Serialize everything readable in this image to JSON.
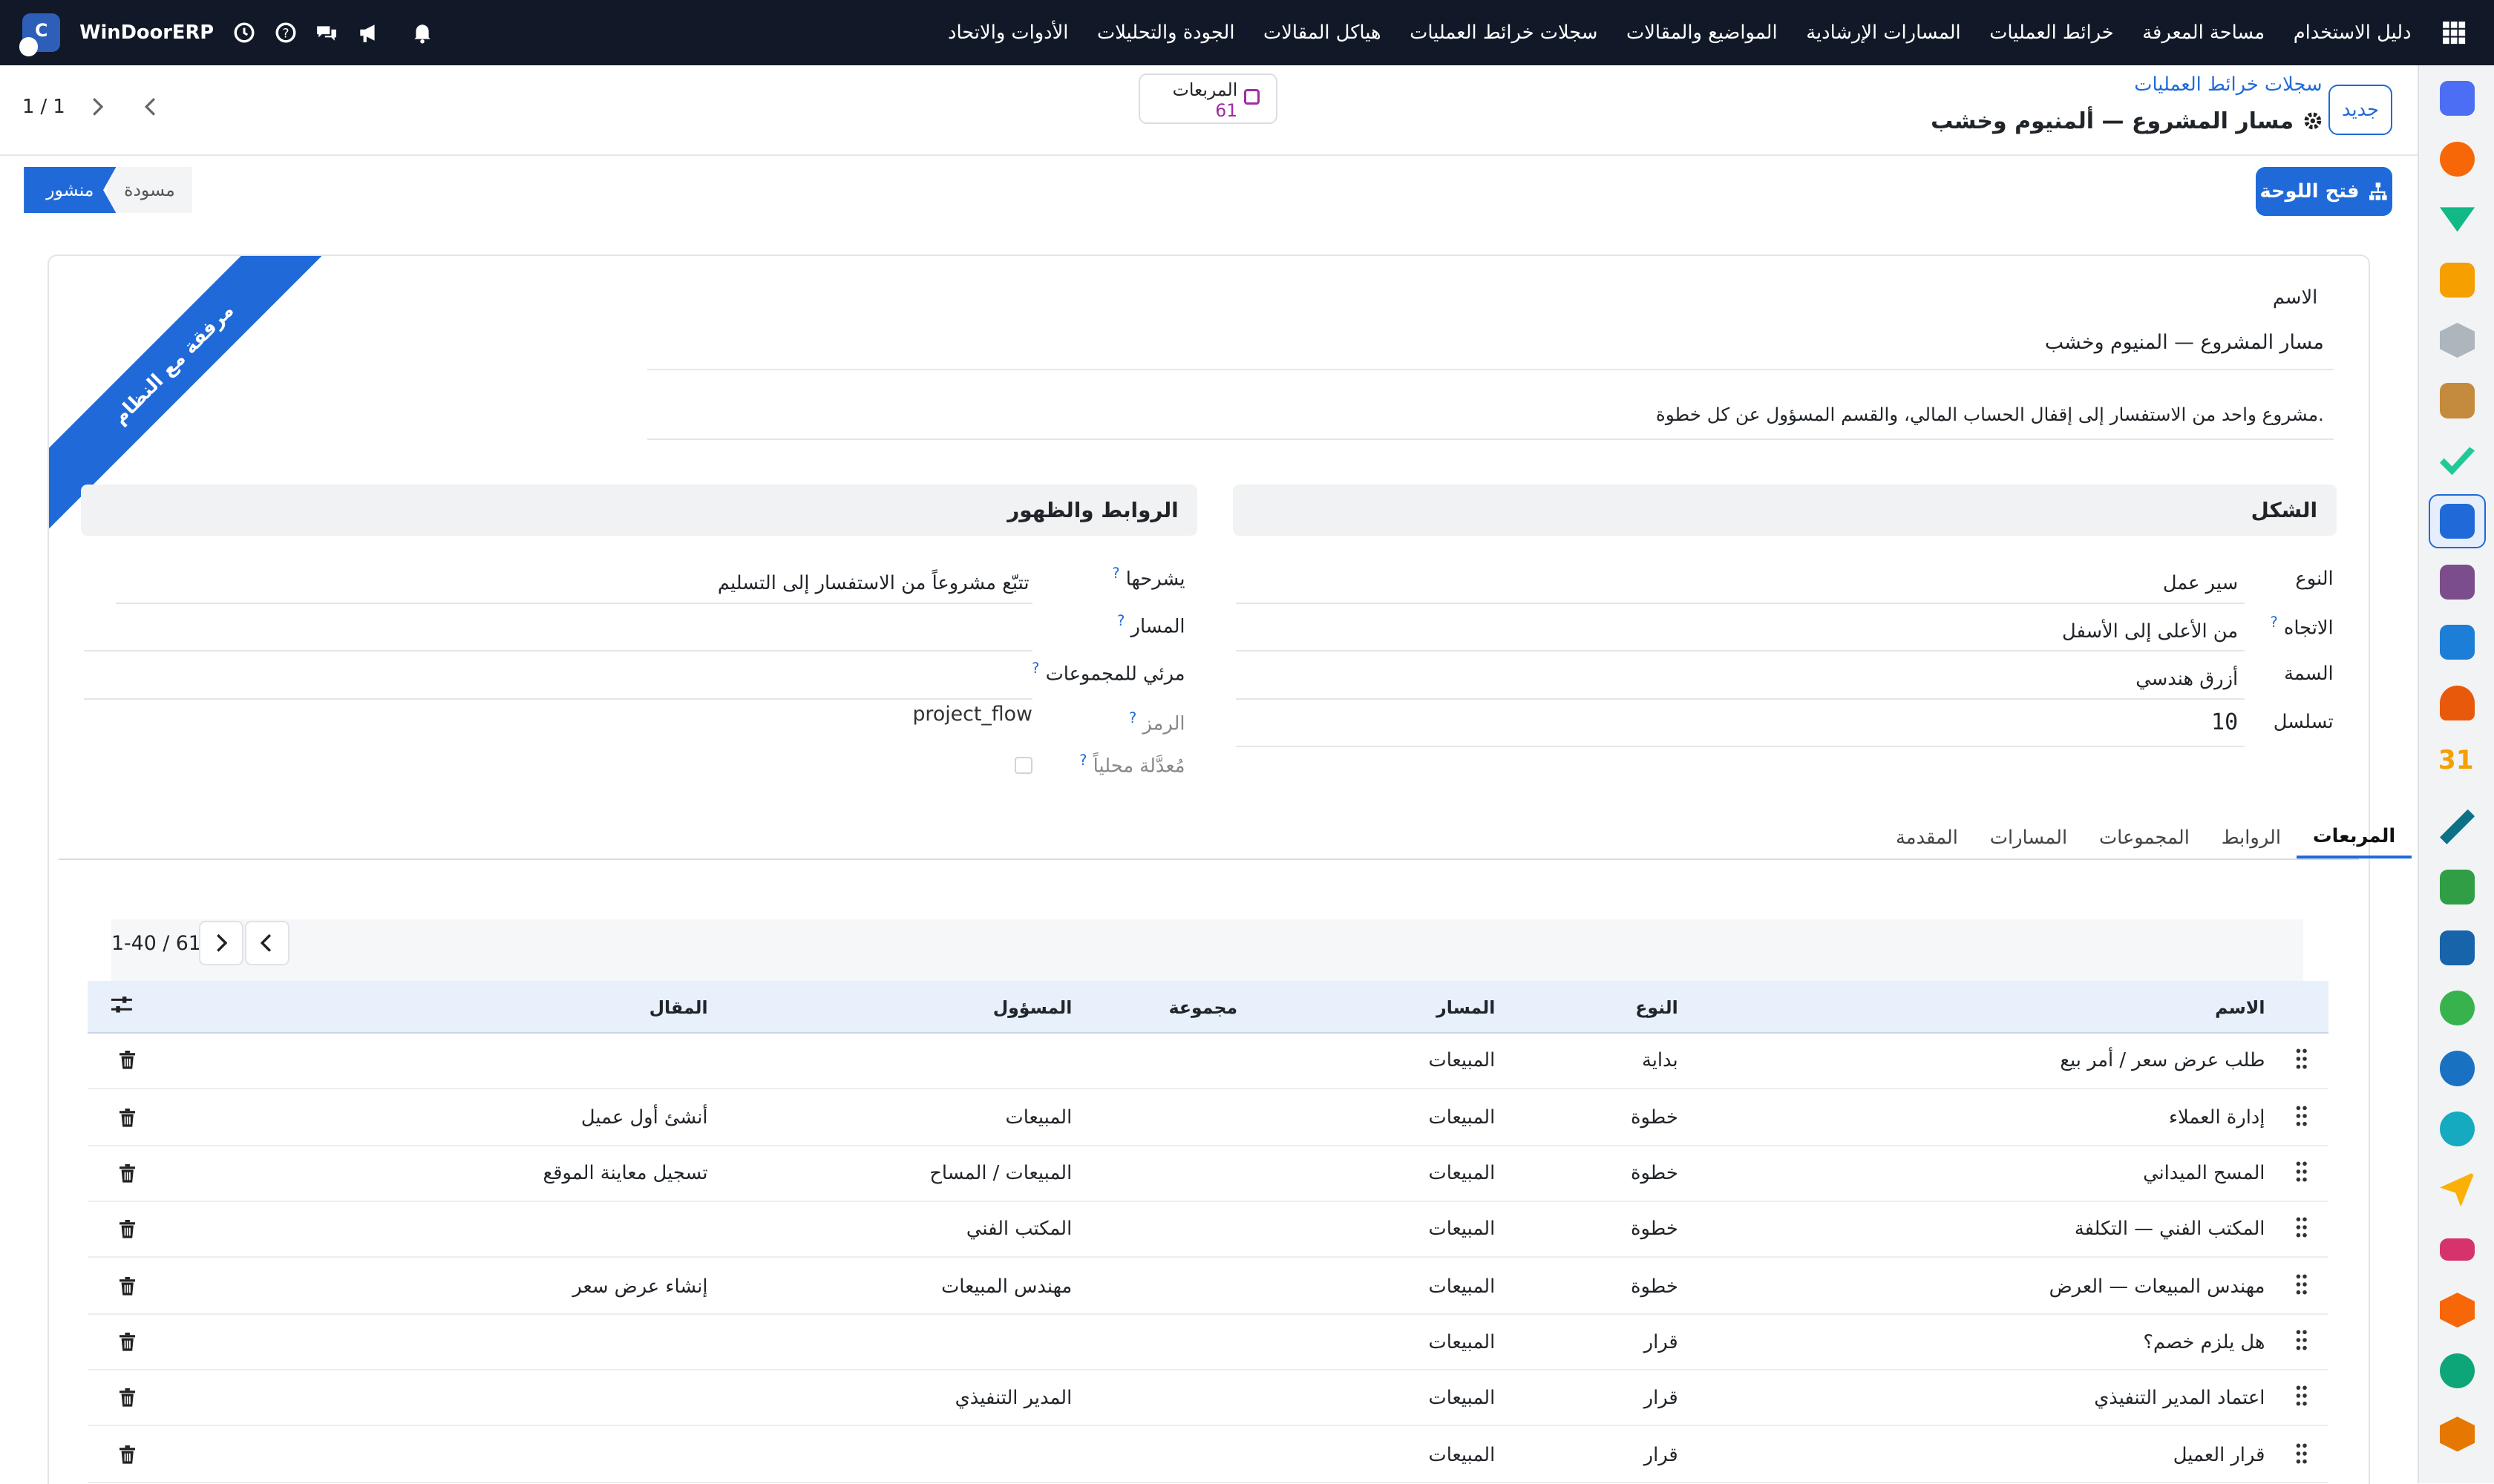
{
  "navbar": {
    "brand": "WinDoorERP",
    "menu": [
      "دليل الاستخدام",
      "مساحة المعرفة",
      "خرائط العمليات",
      "المسارات الإرشادية",
      "المواضيع والمقالات",
      "سجلات خرائط العمليات",
      "هياكل المقالات",
      "الجودة والتحليلات",
      "الأدوات والاتحاد"
    ]
  },
  "control": {
    "new_label": "جديد",
    "breadcrumb_parent": "سجلات خرائط العمليات",
    "breadcrumb_current": "مسار المشروع — ألمنيوم وخشب",
    "stat_label": "المربعات",
    "stat_value": "61",
    "pager": "1 / 1"
  },
  "buttons": {
    "open_board": "فتح اللوحة",
    "status_published": "منشور",
    "status_draft": "مسودة"
  },
  "ribbon": "مرفقة مع النظام",
  "form": {
    "name_label": "الاسم",
    "name_value": "مسار المشروع — المنيوم وخشب",
    "description": "مشروع واحد من الاستفسار إلى إقفال الحساب المالي، والقسم المسؤول عن كل خطوة.",
    "shape_header": "الشكل",
    "links_header": "الروابط والظهور",
    "type_label": "النوع",
    "type_value": "سير عمل",
    "direction_label": "الاتجاه",
    "direction_value": "من الأعلى إلى الأسفل",
    "theme_label": "السمة",
    "theme_value": "أزرق هندسي",
    "sequence_label": "تسلسل",
    "sequence_value": "10",
    "explains_label": "يشرحها",
    "explains_value": "تتبّع مشروعاً من الاستفسار إلى التسليم",
    "path_label": "المسار",
    "groups_label": "مرئي للمجموعات",
    "code_label": "الرمز",
    "code_value": "project_flow",
    "modified_label": "مُعدَّلة محلياً"
  },
  "tabs": [
    "المربعات",
    "الروابط",
    "المجموعات",
    "المسارات",
    "المقدمة"
  ],
  "table": {
    "pager": "1-40 / 61",
    "headers": {
      "name": "الاسم",
      "type": "النوع",
      "path": "المسار",
      "group": "مجموعة",
      "owner": "المسؤول",
      "article": "المقال"
    },
    "rows": [
      {
        "name": "طلب عرض سعر / أمر بيع",
        "type": "بداية",
        "path": "المبيعات",
        "owner": "",
        "article": ""
      },
      {
        "name": "إدارة العملاء",
        "type": "خطوة",
        "path": "المبيعات",
        "owner": "المبيعات",
        "article": "أنشئ أول عميل"
      },
      {
        "name": "المسح الميداني",
        "type": "خطوة",
        "path": "المبيعات",
        "owner": "المبيعات / المساح",
        "article": "تسجيل معاينة الموقع"
      },
      {
        "name": "المكتب الفني — التكلفة",
        "type": "خطوة",
        "path": "المبيعات",
        "owner": "المكتب الفني",
        "article": ""
      },
      {
        "name": "مهندس المبيعات — العرض",
        "type": "خطوة",
        "path": "المبيعات",
        "owner": "مهندس المبيعات",
        "article": "إنشاء عرض سعر"
      },
      {
        "name": "هل يلزم خصم؟",
        "type": "قرار",
        "path": "المبيعات",
        "owner": "",
        "article": ""
      },
      {
        "name": "اعتماد المدير التنفيذي",
        "type": "قرار",
        "path": "المبيعات",
        "owner": "المدير التنفيذي",
        "article": ""
      },
      {
        "name": "قرار العميل",
        "type": "قرار",
        "path": "المبيعات",
        "owner": "",
        "article": ""
      }
    ]
  },
  "colors": {
    "primary": "#1f6ad8",
    "navbar": "#111827",
    "accent": "#a02da3"
  }
}
